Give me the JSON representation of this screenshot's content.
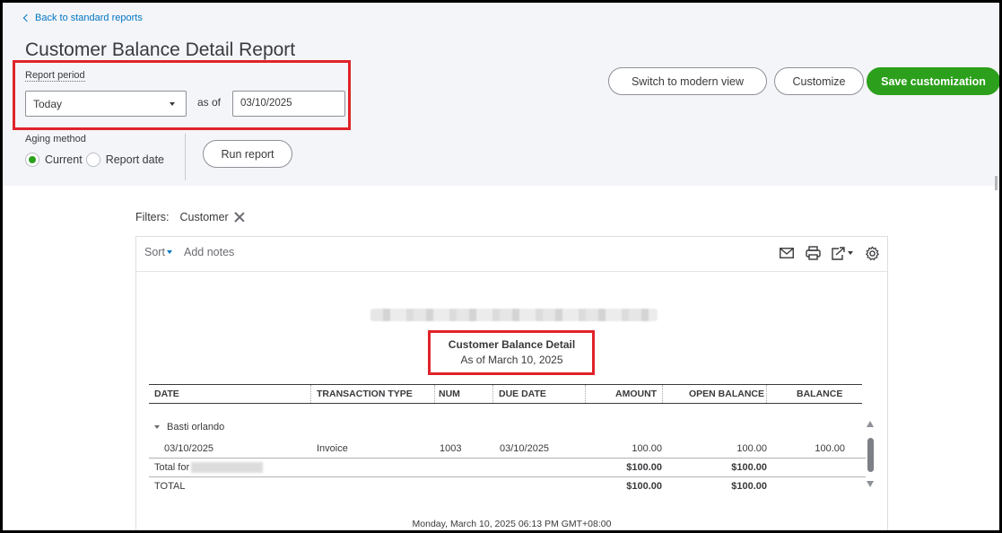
{
  "nav": {
    "back_label": "Back to standard reports"
  },
  "page": {
    "title": "Customer Balance Detail Report"
  },
  "report_period": {
    "label": "Report period",
    "selected": "Today",
    "as_of_label": "as of",
    "date_value": "03/10/2025"
  },
  "aging": {
    "label": "Aging method",
    "options": [
      {
        "label": "Current",
        "checked": true
      },
      {
        "label": "Report date",
        "checked": false
      }
    ]
  },
  "buttons": {
    "run_report": "Run report",
    "switch_modern": "Switch to modern view",
    "customize": "Customize",
    "save_customization": "Save customization"
  },
  "filters": {
    "label": "Filters:",
    "chip": "Customer"
  },
  "toolbar": {
    "sort_label": "Sort",
    "add_notes": "Add notes",
    "icons": [
      "email-icon",
      "print-icon",
      "export-icon",
      "settings-icon"
    ]
  },
  "report": {
    "title": "Customer Balance Detail",
    "subtitle": "As of March 10, 2025",
    "columns": [
      "DATE",
      "TRANSACTION TYPE",
      "NUM",
      "DUE DATE",
      "AMOUNT",
      "OPEN BALANCE",
      "BALANCE"
    ],
    "group": {
      "name": "Basti orlando",
      "rows": [
        {
          "date": "03/10/2025",
          "type": "Invoice",
          "num": "1003",
          "due_date": "03/10/2025",
          "amount": "100.00",
          "open_balance": "100.00",
          "balance": "100.00"
        }
      ],
      "total_label": "Total for",
      "total_amount": "$100.00",
      "total_open_balance": "$100.00"
    },
    "grand_total": {
      "label": "TOTAL",
      "amount": "$100.00",
      "open_balance": "$100.00"
    },
    "footer_timestamp": "Monday, March 10, 2025   06:13 PM GMT+08:00"
  },
  "colors": {
    "accent_green": "#2ca01c",
    "link_blue": "#0077c5",
    "highlight_red": "#e0232a"
  }
}
